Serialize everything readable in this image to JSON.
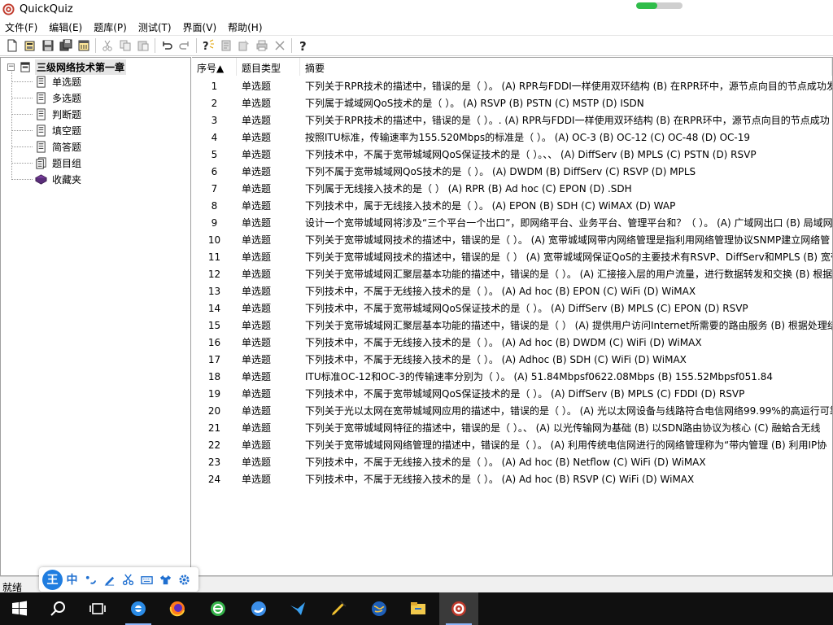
{
  "window": {
    "title": "QuickQuiz",
    "progress_fraction": 0.45
  },
  "menu": [
    "文件(F)",
    "编辑(E)",
    "题库(P)",
    "测试(T)",
    "界面(V)",
    "帮助(H)"
  ],
  "toolbar_icons": [
    "new-file-icon",
    "open-icon",
    "save-icon",
    "save-all-icon",
    "properties-icon",
    "cut-icon",
    "copy-icon",
    "paste-icon",
    "undo-icon",
    "redo-icon",
    "add-question-icon",
    "edit-question-icon",
    "delete-doc-icon",
    "print-icon",
    "close-x-icon",
    "help-icon"
  ],
  "tree": {
    "root": "三级网络技术第一章",
    "children": [
      "单选题",
      "多选题",
      "判断题",
      "填空题",
      "简答题",
      "题目组",
      "收藏夹"
    ]
  },
  "list": {
    "headers": {
      "num": "序号▲",
      "type": "题目类型",
      "summary": "摘要"
    },
    "rows": [
      {
        "num": "1",
        "type": "单选题",
        "summary": "下列关于RPR技术的描述中，错误的是（ ）。 (A) RPR与FDDI一样使用双环结构  (B) 在RPR环中，源节点向目的节点成功发出"
      },
      {
        "num": "2",
        "type": "单选题",
        "summary": "下列属于城域网QoS技术的是（ ）。 (A) RSVP  (B) PSTN  (C) MSTP  (D) ISDN"
      },
      {
        "num": "3",
        "type": "单选题",
        "summary": "下列关于RPR技术的描述中，错误的是（ ）。. (A) RPR与FDDI一样使用双环结构  (B) 在RPR环中，源节点向目的节点成功"
      },
      {
        "num": "4",
        "type": "单选题",
        "summary": "按照ITU标准，传输速率为155.520Mbps的标准是（ ）。 (A) OC-3  (B) OC-12  (C) OC-48  (D) OC-19"
      },
      {
        "num": "5",
        "type": "单选题",
        "summary": "下列技术中，不属于宽带城域网QoS保证技术的是（ ）。、、 (A) DiffServ  (B) MPLS  (C) PSTN  (D) RSVP"
      },
      {
        "num": "6",
        "type": "单选题",
        "summary": "下列不属于宽带城域网QoS技术的是（ ）。 (A) DWDM  (B) DiffServ  (C) RSVP  (D) MPLS"
      },
      {
        "num": "7",
        "type": "单选题",
        "summary": "下列属于无线接入技术的是（ ）  (A) RPR  (B) Ad hoc  (C) EPON  (D) .SDH"
      },
      {
        "num": "8",
        "type": "单选题",
        "summary": "下列技术中，属于无线接入技术的是（ ）。 (A) EPON  (B) SDH  (C) WiMAX  (D) WAP"
      },
      {
        "num": "9",
        "type": "单选题",
        "summary": "设计一个宽带城域网将涉及“三个平台一个出口”，即网络平台、业务平台、管理平台和？（ ）。 (A) 广域网出口  (B) 局域网"
      },
      {
        "num": "10",
        "type": "单选题",
        "summary": "下列关于宽带城域网技术的描述中，错误的是（ ）。 (A) 宽带城域网带内网络管理是指利用网络管理协议SNMP建立网络管"
      },
      {
        "num": "11",
        "type": "单选题",
        "summary": "下列关于宽带城域网技术的描述中，错误的是（ ）  (A) 宽带城域网保证QoS的主要技术有RSVP、DiffServ和MPLS  (B) 宽带"
      },
      {
        "num": "12",
        "type": "单选题",
        "summary": "下列关于宽带城域网汇聚层基本功能的描述中，错误的是（ ）。 (A) 汇接接入层的用户流量，进行数据转发和交换  (B) 根据"
      },
      {
        "num": "13",
        "type": "单选题",
        "summary": "下列技术中，不属于无线接入技术的是（ ）。 (A) Ad hoc  (B) EPON  (C) WiFi  (D) WiMAX"
      },
      {
        "num": "14",
        "type": "单选题",
        "summary": "下列技术中，不属于宽带城域网QoS保证技术的是（ ）。 (A) DiffServ  (B) MPLS  (C) EPON  (D) RSVP"
      },
      {
        "num": "15",
        "type": "单选题",
        "summary": "下列关于宽带城域网汇聚层基本功能的描述中，错误的是（ ）  (A) 提供用户访问Internet所需要的路由服务  (B) 根据处理结"
      },
      {
        "num": "16",
        "type": "单选题",
        "summary": "下列技术中，不属于无线接入技术的是（ ）。 (A) Ad hoc  (B) DWDM  (C) WiFi  (D) WiMAX"
      },
      {
        "num": "17",
        "type": "单选题",
        "summary": "下列技术中，不属于无线接入技术的是（ ）。 (A) Adhoc  (B) SDH  (C) WiFi  (D) WiMAX"
      },
      {
        "num": "18",
        "type": "单选题",
        "summary": "ITU标准OC-12和OC-3的传输速率分别为（ ）。 (A) 51.84Mbpsf0622.08Mbps  (B) 155.52Mbpsf051.84"
      },
      {
        "num": "19",
        "type": "单选题",
        "summary": "下列技术中，不属于宽带城域网QoS保证技术的是（ ）。 (A) DiffServ  (B) MPLS  (C) FDDI  (D) RSVP"
      },
      {
        "num": "20",
        "type": "单选题",
        "summary": "下列关于光以太网在宽带城域网应用的描述中，错误的是（ ）。 (A) 光以太网设备与线路符合电信网络99.99%的高运行可靠"
      },
      {
        "num": "21",
        "type": "单选题",
        "summary": "下列关于宽带城域网特征的描述中，错误的是（ ）。、 (A) 以光传输网为基础  (B) 以SDN路由协议为核心  (C) 融蛤合无线"
      },
      {
        "num": "22",
        "type": "单选题",
        "summary": "下列关于宽带城域网网络管理的描述中，错误的是（ ）。 (A) 利用传统电信网进行的网络管理称为“带内管理  (B) 利用IP协"
      },
      {
        "num": "23",
        "type": "单选题",
        "summary": "下列技术中，不属于无线接入技术的是（ ）。 (A) Ad hoc  (B) Netflow  (C) WiFi  (D) WiMAX"
      },
      {
        "num": "24",
        "type": "单选题",
        "summary": "下列技术中，不属于无线接入技术的是（ ）。 (A) Ad hoc  (B) RSVP  (C) WiFi  (D) WiMAX"
      }
    ]
  },
  "status": {
    "text": "就绪"
  },
  "ime": {
    "logo": "王",
    "mode": "中"
  },
  "taskbar": [
    "windows-start-icon",
    "search-icon",
    "task-view-icon",
    "ie-browser-icon",
    "firefox-icon",
    "360-browser-icon",
    "sogou-browser-icon",
    "feishu-app-icon",
    "pencil-app-icon",
    "globe-app-icon",
    "file-explorer-icon",
    "quickquiz-app-icon"
  ]
}
